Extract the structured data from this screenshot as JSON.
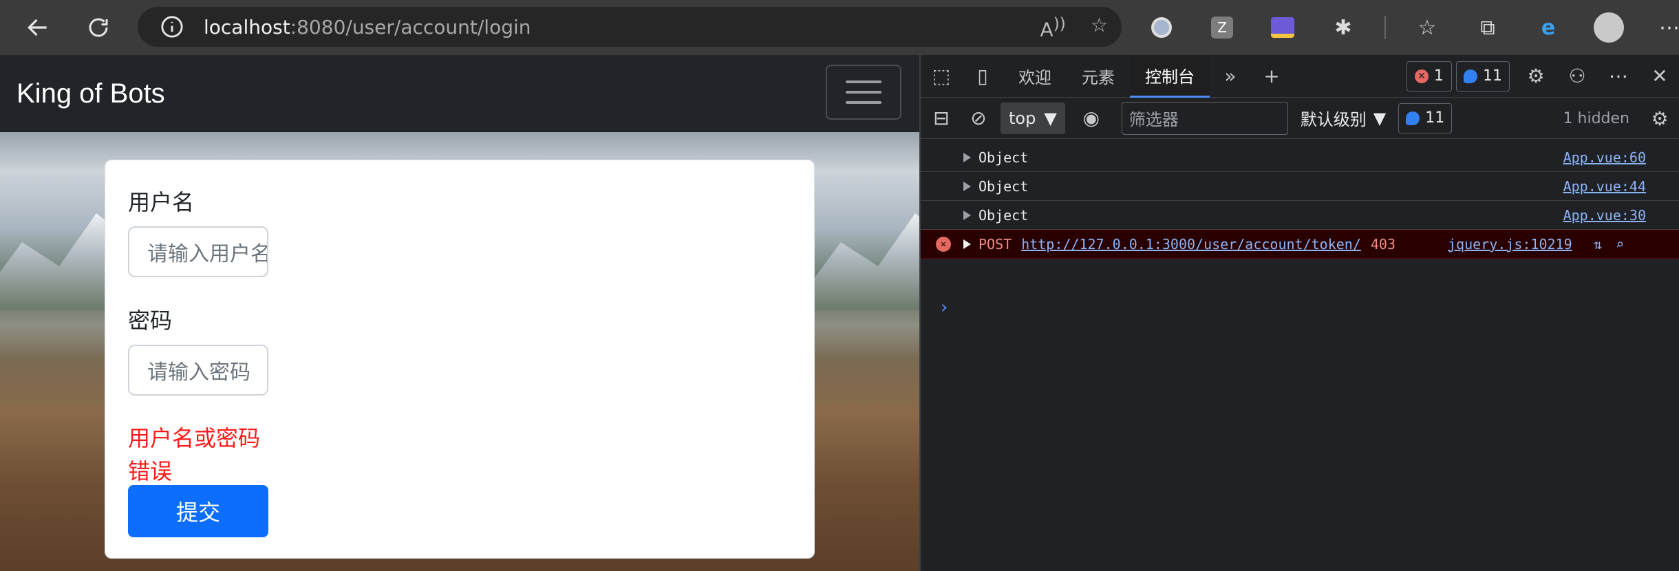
{
  "browser": {
    "url_host": "localhost",
    "url_path": ":8080/user/account/login",
    "back_icon": "arrow-left",
    "refresh_icon": "refresh",
    "info_icon": "info-circle"
  },
  "page": {
    "brand": "King of Bots",
    "form": {
      "username_label": "用户名",
      "username_placeholder": "请输入用户名",
      "password_label": "密码",
      "password_placeholder": "请输入密码",
      "error_message": "用户名或密码错误",
      "submit_label": "提交"
    },
    "colors": {
      "primary": "#0d6efd",
      "error": "#ff1a1a",
      "navbar": "#212529"
    }
  },
  "devtools": {
    "tabs": [
      "欢迎",
      "元素",
      "控制台"
    ],
    "active_tab": "控制台",
    "error_count": "1",
    "message_count": "11",
    "context": "top",
    "filter_placeholder": "筛选器",
    "level": "默认级别",
    "message_badge": "11",
    "hidden": "1 hidden",
    "logs": [
      {
        "text": "Object",
        "source": "App.vue:60"
      },
      {
        "text": "Object",
        "source": "App.vue:44"
      },
      {
        "text": "Object",
        "source": "App.vue:30"
      }
    ],
    "error_log": {
      "method": "POST",
      "url": "http://127.0.0.1:3000/user/account/token/",
      "status": "403",
      "source": "jquery.js:10219"
    },
    "prompt": "›"
  }
}
